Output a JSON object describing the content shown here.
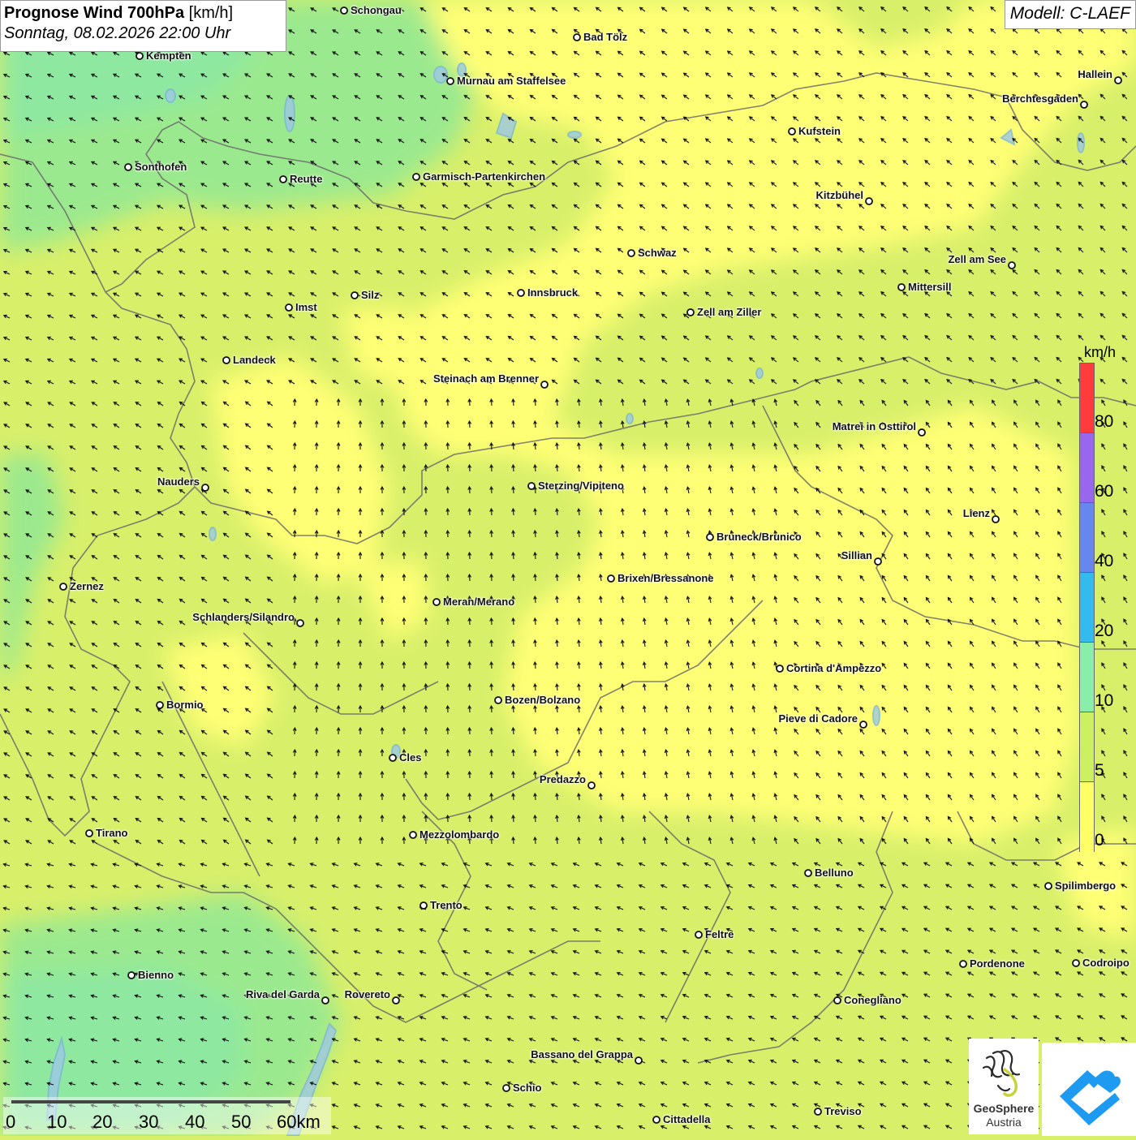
{
  "title": {
    "main": "Prognose Wind 700hPa",
    "unit": "[km/h]",
    "datetime": "Sonntag, 08.02.2026 22:00 Uhr"
  },
  "model": "Modell: C-LAEF",
  "colors": {
    "yellow": "#ffff74",
    "lime": "#d8ef6a",
    "green": "#b3ec7e",
    "mint": "#8ee8a0"
  },
  "legend": {
    "unit": "km/h",
    "ticks": [
      "80",
      "60",
      "40",
      "20",
      "10",
      "5",
      "0"
    ],
    "colors": [
      "#ff3b3b",
      "#9966ee",
      "#6688ee",
      "#33bbee",
      "#88eeaa",
      "#ccf060",
      "#ffff66"
    ]
  },
  "scale": {
    "labels": [
      "0",
      "10",
      "20",
      "30",
      "40",
      "50",
      "60km"
    ]
  },
  "logos": {
    "geosphere_name": "GeoSphere",
    "geosphere_country": "Austria",
    "app_icon": "mountain-drop-icon"
  },
  "cities": [
    {
      "name": "Schongau",
      "side": "r"
    },
    {
      "name": "Bad Tölz",
      "side": "r"
    },
    {
      "name": "Kempten",
      "side": "r"
    },
    {
      "name": "Murnau am Staffelsee",
      "side": "r"
    },
    {
      "name": "Hallein",
      "side": "l"
    },
    {
      "name": "Berchtesgaden",
      "side": "l"
    },
    {
      "name": "Kufstein",
      "side": "r"
    },
    {
      "name": "Sonthofen",
      "side": "r"
    },
    {
      "name": "Reutte",
      "side": "r"
    },
    {
      "name": "Garmisch-Partenkirchen",
      "side": "r"
    },
    {
      "name": "Kitzbühel",
      "side": "l"
    },
    {
      "name": "Schwaz",
      "side": "r"
    },
    {
      "name": "Zell am See",
      "side": "l"
    },
    {
      "name": "Mittersill",
      "side": "r"
    },
    {
      "name": "Innsbruck",
      "side": "r"
    },
    {
      "name": "Silz",
      "side": "r"
    },
    {
      "name": "Imst",
      "side": "r"
    },
    {
      "name": "Zell am Ziller",
      "side": "r"
    },
    {
      "name": "Landeck",
      "side": "r"
    },
    {
      "name": "Steinach am Brenner",
      "side": "l"
    },
    {
      "name": "Matrei in Osttirol",
      "side": "l"
    },
    {
      "name": "Nauders",
      "side": "l"
    },
    {
      "name": "Sterzing/Vipiteno",
      "side": "r"
    },
    {
      "name": "Lienz",
      "side": "l"
    },
    {
      "name": "Bruneck/Brunico",
      "side": "r"
    },
    {
      "name": "Sillian",
      "side": "l"
    },
    {
      "name": "Brixen/Bressanone",
      "side": "r"
    },
    {
      "name": "Zernez",
      "side": "r"
    },
    {
      "name": "Meran/Merano",
      "side": "r"
    },
    {
      "name": "Schlanders/Silandro",
      "side": "l"
    },
    {
      "name": "Cortina d'Ampezzo",
      "side": "r"
    },
    {
      "name": "Bozen/Bolzano",
      "side": "r"
    },
    {
      "name": "Bormio",
      "side": "r"
    },
    {
      "name": "Pieve di Cadore",
      "side": "l"
    },
    {
      "name": "Cles",
      "side": "r"
    },
    {
      "name": "Predazzo",
      "side": "l"
    },
    {
      "name": "Tirano",
      "side": "r"
    },
    {
      "name": "Mezzolombardo",
      "side": "r"
    },
    {
      "name": "Belluno",
      "side": "r"
    },
    {
      "name": "Spilimbergo",
      "side": "r"
    },
    {
      "name": "Trento",
      "side": "r"
    },
    {
      "name": "Feltre",
      "side": "r"
    },
    {
      "name": "Pordenone",
      "side": "r"
    },
    {
      "name": "Codroipo",
      "side": "r"
    },
    {
      "name": "Bienno",
      "side": "r"
    },
    {
      "name": "Riva del Garda",
      "side": "l"
    },
    {
      "name": "Rovereto",
      "side": "l"
    },
    {
      "name": "Conegliano",
      "side": "r"
    },
    {
      "name": "Bassano del Grappa",
      "side": "l"
    },
    {
      "name": "Schio",
      "side": "r"
    },
    {
      "name": "Treviso",
      "side": "r"
    },
    {
      "name": "Cittadella",
      "side": "r"
    }
  ]
}
